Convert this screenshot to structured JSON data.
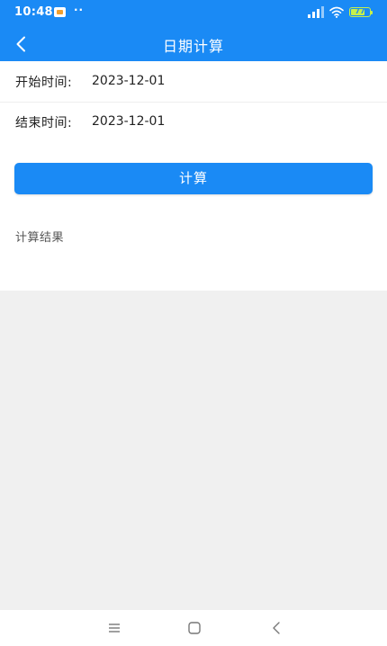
{
  "status_bar": {
    "time": "10:48",
    "dots": "··",
    "battery_level": "77",
    "battery_fraction": 0.77,
    "battery_color": "#c6f04a"
  },
  "app_bar": {
    "title": "日期计算",
    "back_icon": "back-arrow-icon",
    "background_color": "#1a8af5"
  },
  "form": {
    "start_label": "开始时间:",
    "start_value": "2023-12-01",
    "end_label": "结束时间:",
    "end_value": "2023-12-01"
  },
  "calculate_button": {
    "label": "计算",
    "color": "#1a8af5"
  },
  "result": {
    "label": "计算结果"
  },
  "nav_bar": {
    "menu_icon": "menu-icon",
    "home_icon": "home-icon",
    "back_icon": "back-icon"
  }
}
